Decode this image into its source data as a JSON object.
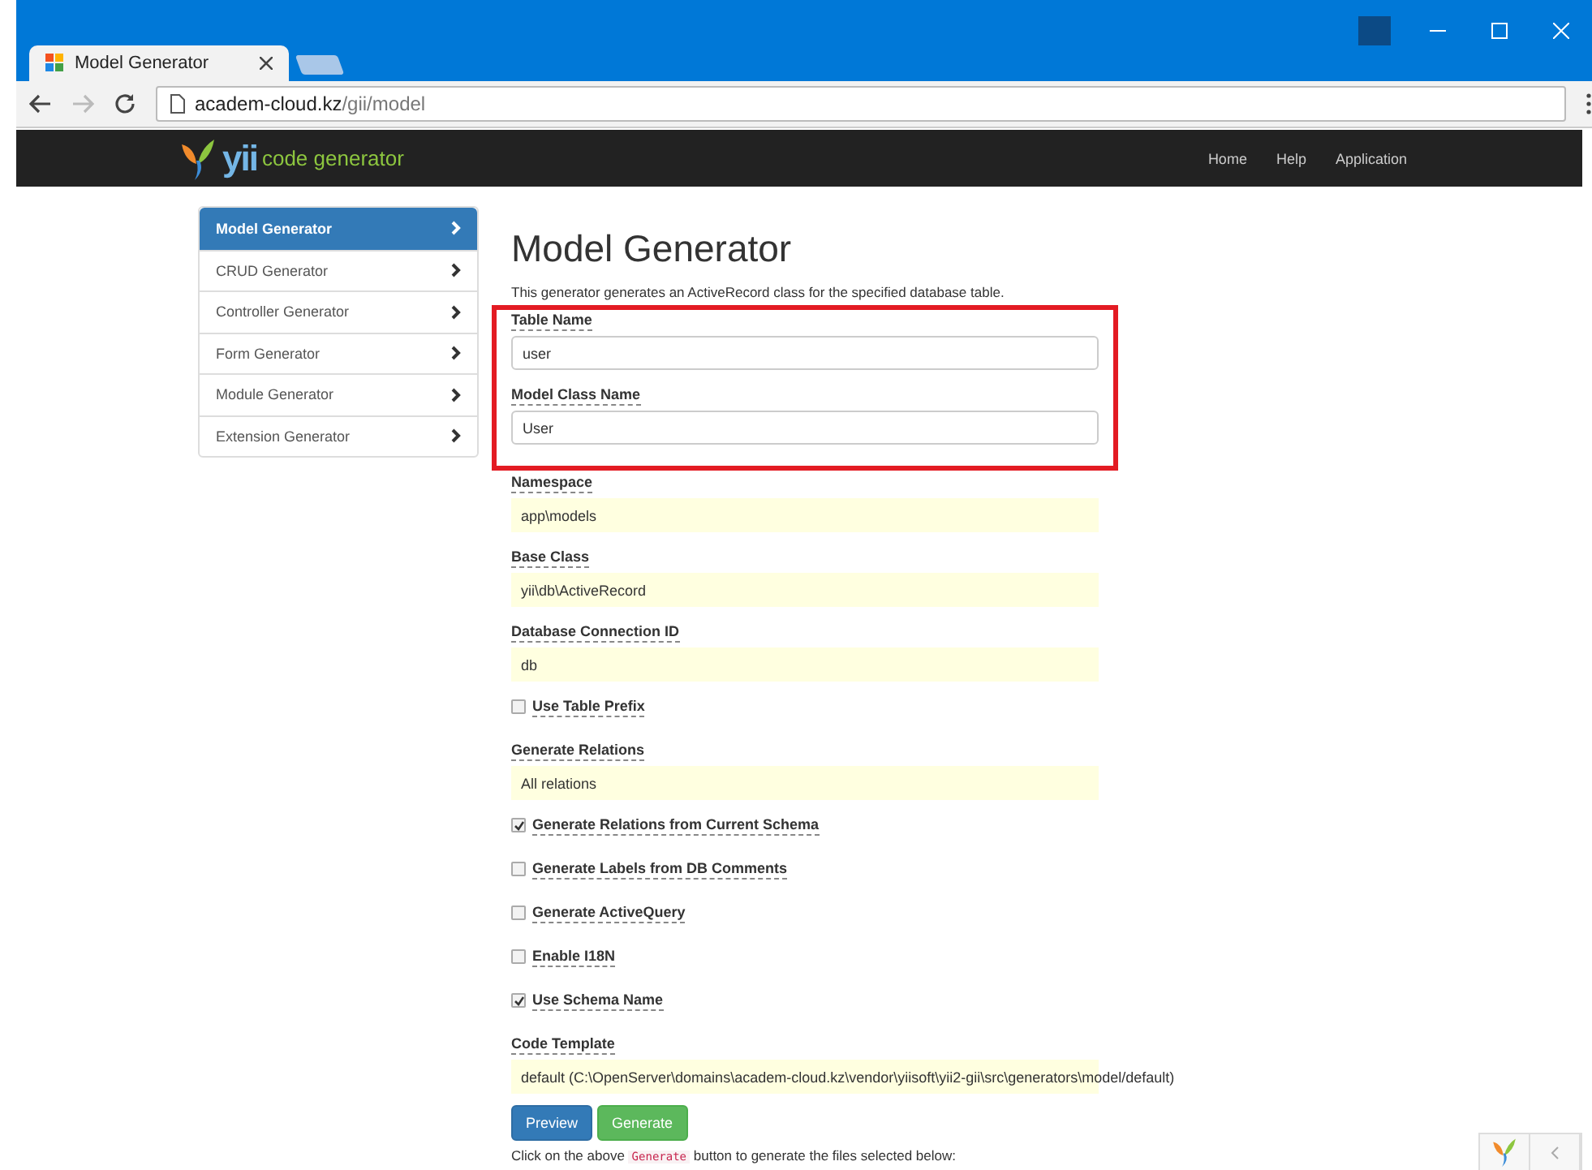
{
  "browser": {
    "tab_title": "Model Generator",
    "url_host": "academ-cloud.kz",
    "url_path": "/gii/model"
  },
  "navbar": {
    "logo_brand": "yii",
    "logo_text": "code generator",
    "links": [
      "Home",
      "Help",
      "Application"
    ]
  },
  "sidebar": {
    "items": [
      {
        "label": "Model Generator",
        "selected": true
      },
      {
        "label": "CRUD Generator",
        "selected": false
      },
      {
        "label": "Controller Generator",
        "selected": false
      },
      {
        "label": "Form Generator",
        "selected": false
      },
      {
        "label": "Module Generator",
        "selected": false
      },
      {
        "label": "Extension Generator",
        "selected": false
      }
    ]
  },
  "main": {
    "title": "Model Generator",
    "description": "This generator generates an ActiveRecord class for the specified database table.",
    "fields": [
      {
        "kind": "text",
        "label": "Table Name",
        "value": "user",
        "highlighted": true
      },
      {
        "kind": "text",
        "label": "Model Class Name",
        "value": "User",
        "highlighted": true
      },
      {
        "kind": "sticky",
        "label": "Namespace",
        "value": "app\\models",
        "highlighted": false
      },
      {
        "kind": "sticky",
        "label": "Base Class",
        "value": "yii\\db\\ActiveRecord",
        "highlighted": false
      },
      {
        "kind": "sticky",
        "label": "Database Connection ID",
        "value": "db",
        "highlighted": false
      },
      {
        "kind": "checkbox",
        "label": "Use Table Prefix",
        "checked": false,
        "highlighted": false
      },
      {
        "kind": "sticky",
        "label": "Generate Relations",
        "value": "All relations",
        "highlighted": false
      },
      {
        "kind": "checkbox",
        "label": "Generate Relations from Current Schema",
        "checked": true,
        "highlighted": false
      },
      {
        "kind": "checkbox",
        "label": "Generate Labels from DB Comments",
        "checked": false,
        "highlighted": false
      },
      {
        "kind": "checkbox",
        "label": "Generate ActiveQuery",
        "checked": false,
        "highlighted": false
      },
      {
        "kind": "checkbox",
        "label": "Enable I18N",
        "checked": false,
        "highlighted": false
      },
      {
        "kind": "checkbox",
        "label": "Use Schema Name",
        "checked": true,
        "highlighted": false
      },
      {
        "kind": "sticky",
        "label": "Code Template",
        "value": "default (C:\\OpenServer\\domains\\academ-cloud.kz\\vendor\\yiisoft\\yii2-gii\\src\\generators\\model/default)",
        "highlighted": false
      }
    ],
    "buttons": [
      {
        "kind": "primary",
        "label": "Preview"
      },
      {
        "kind": "success",
        "label": "Generate"
      }
    ],
    "footnote": {
      "before": "Click on the above",
      "code": "Generate",
      "after": "button to generate the files selected below:"
    }
  }
}
